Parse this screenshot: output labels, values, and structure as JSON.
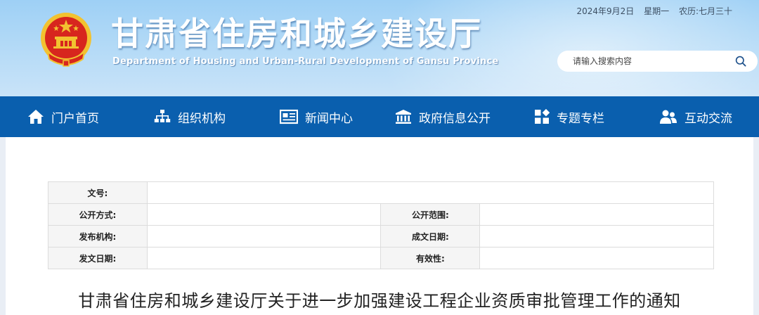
{
  "header": {
    "title": "甘肃省住房和城乡建设厅",
    "subtitle": "Department of Housing and Urban-Rural Development of Gansu Province",
    "date": "2024年9月2日",
    "weekday": "星期一",
    "lunar": "农历:七月三十"
  },
  "search": {
    "placeholder": "请输入搜索内容"
  },
  "nav": {
    "items": [
      {
        "label": "门户首页",
        "icon": "home-icon"
      },
      {
        "label": "组织机构",
        "icon": "org-chart-icon"
      },
      {
        "label": "新闻中心",
        "icon": "newspaper-icon"
      },
      {
        "label": "政府信息公开",
        "icon": "government-building-icon"
      },
      {
        "label": "专题专栏",
        "icon": "grid-icon"
      },
      {
        "label": "互动交流",
        "icon": "people-icon"
      }
    ]
  },
  "meta": {
    "doc_number_label": "文号:",
    "doc_number_value": "",
    "disclosure_method_label": "公开方式:",
    "disclosure_method_value": "",
    "disclosure_scope_label": "公开范围:",
    "disclosure_scope_value": "",
    "issuer_label": "发布机构:",
    "issuer_value": "",
    "written_date_label": "成文日期:",
    "written_date_value": "",
    "publish_date_label": "发文日期:",
    "publish_date_value": "",
    "validity_label": "有效性:",
    "validity_value": ""
  },
  "article": {
    "title": "甘肃省住房和城乡建设厅关于进一步加强建设工程企业资质审批管理工作的通知"
  },
  "colors": {
    "nav_bg": "#0a5fae",
    "header_sky": "#b8dcf7",
    "emblem_red": "#d7261e",
    "emblem_gold": "#f2c230"
  }
}
